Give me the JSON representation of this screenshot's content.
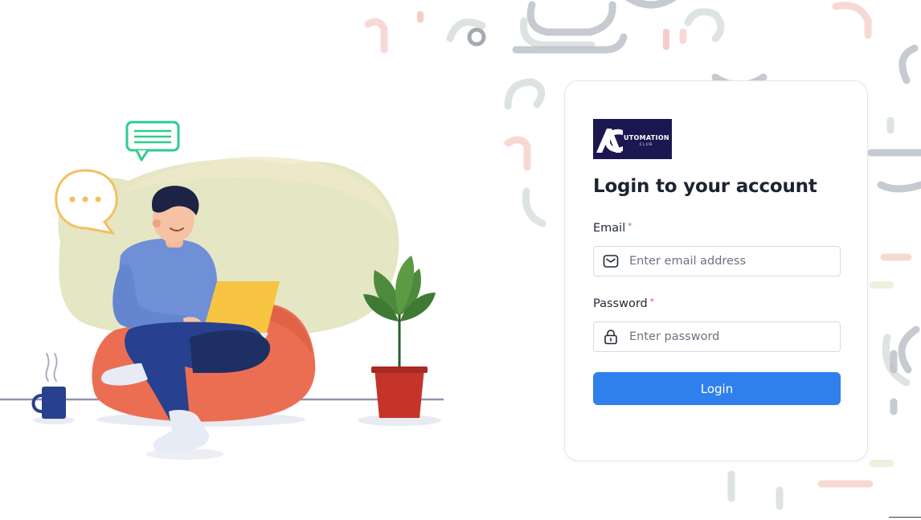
{
  "logo": {
    "text": "UTOMATION",
    "sub": "CLUB",
    "colors": {
      "background": "#1b1851",
      "text": "#ffffff"
    }
  },
  "login": {
    "title": "Login to your account",
    "email": {
      "label": "Email",
      "required_mark": "*",
      "placeholder": "Enter email address",
      "value": "",
      "icon": "mail-icon"
    },
    "password": {
      "label": "Password",
      "required_mark": "*",
      "placeholder": "Enter password",
      "value": "",
      "icon": "lock-icon"
    },
    "button_label": "Login"
  },
  "colors": {
    "accent": "#2f80ed",
    "required": "#e5484d",
    "text": "#1c2430",
    "card_border": "#e3e6ea"
  },
  "illustration": {
    "description_icon": "person-with-laptop-illustration",
    "elements": [
      "chat-bubble-icon",
      "speech-bubble-icon",
      "coffee-mug-icon",
      "potted-plant-icon",
      "bean-bag-chair"
    ]
  }
}
